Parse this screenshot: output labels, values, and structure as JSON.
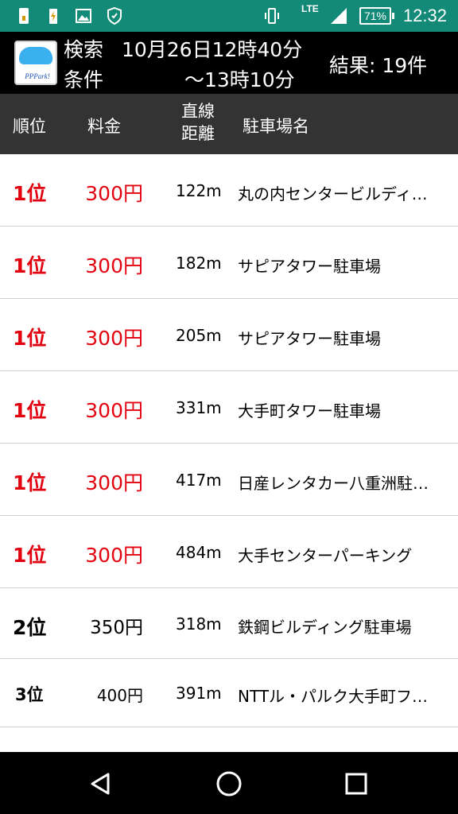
{
  "status_bar": {
    "network": "LTE",
    "battery": "71%",
    "time": "12:32"
  },
  "header": {
    "line1_label": "検索",
    "line1_value": "10月26日12時40分",
    "line2_label": "条件",
    "line2_value": "～13時10分",
    "result": "結果: 19件",
    "logo_text": "PPPark!"
  },
  "columns": {
    "rank": "順位",
    "price": "料金",
    "distance": "直線\n距離",
    "name": "駐車場名"
  },
  "rows": [
    {
      "rank": "1位",
      "price": "300円",
      "distance": "122m",
      "name": "丸の内センタービルディ…"
    },
    {
      "rank": "1位",
      "price": "300円",
      "distance": "182m",
      "name": "サピアタワー駐車場"
    },
    {
      "rank": "1位",
      "price": "300円",
      "distance": "205m",
      "name": "サピアタワー駐車場"
    },
    {
      "rank": "1位",
      "price": "300円",
      "distance": "331m",
      "name": "大手町タワー駐車場"
    },
    {
      "rank": "1位",
      "price": "300円",
      "distance": "417m",
      "name": "日産レンタカー八重洲駐…"
    },
    {
      "rank": "1位",
      "price": "300円",
      "distance": "484m",
      "name": "大手センターパーキング"
    },
    {
      "rank": "2位",
      "price": "350円",
      "distance": "318m",
      "name": "鉄鋼ビルディング駐車場"
    },
    {
      "rank": "3位",
      "price": "400円",
      "distance": "391m",
      "name": "NTTル・パルク大手町フ…"
    }
  ],
  "colors": {
    "status_bar": "#138a78",
    "rank_red": "#e3000f",
    "header_bg": "#000000",
    "column_header_bg": "#333333"
  }
}
